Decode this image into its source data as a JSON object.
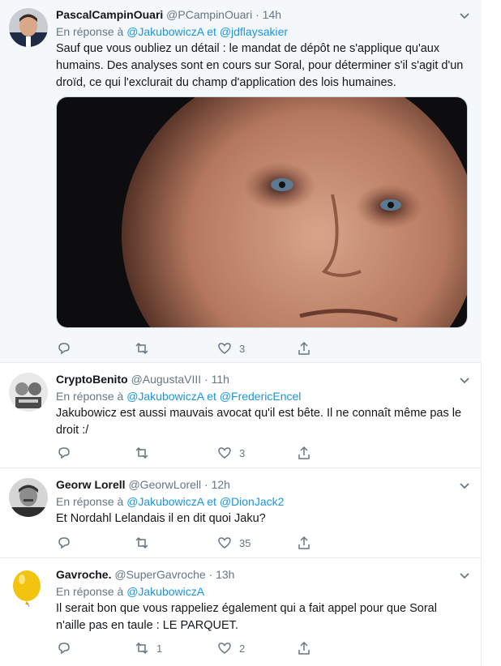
{
  "tweets": [
    {
      "name": "PascalCampinOuari",
      "handle": "@PCampinOuari",
      "dot": "·",
      "time": "14h",
      "reply_prefix": "En réponse à",
      "mentions": [
        "@JakubowiczA",
        "@jdflaysakier"
      ],
      "joiner": "et",
      "text": "Sauf que vous oubliez un détail : le mandat de dépôt ne s'applique qu'aux humains. Des analyses sont en cours sur Soral, pour déterminer s'il s'agit d'un droïd, ce qui l'exclurait du champ d'application des lois humaines.",
      "reply_count": "",
      "retweet_count": "",
      "like_count": "3"
    },
    {
      "name": "CryptoBenito",
      "handle": "@AugustaVIII",
      "dot": "·",
      "time": "11h",
      "reply_prefix": "En réponse à",
      "mentions": [
        "@JakubowiczA",
        "@FredericEncel"
      ],
      "joiner": "et",
      "text": "Jakubowicz est aussi mauvais avocat qu'il est bête. Il ne connaît même pas le droit :/",
      "reply_count": "",
      "retweet_count": "",
      "like_count": "3"
    },
    {
      "name": "Georw Lorell",
      "handle": "@GeorwLorell",
      "dot": "·",
      "time": "12h",
      "reply_prefix": "En réponse à",
      "mentions": [
        "@JakubowiczA",
        "@DionJack2"
      ],
      "joiner": "et",
      "text": "Et Nordahl Lelandais il en dit quoi Jaku?",
      "reply_count": "",
      "retweet_count": "",
      "like_count": "35"
    },
    {
      "name": "Gavroche.",
      "handle": "@SuperGavroche",
      "dot": "·",
      "time": "13h",
      "reply_prefix": "En réponse à",
      "mentions": [
        "@JakubowiczA"
      ],
      "joiner": "",
      "text": "Il serait bon que vous rappeliez également qui a fait appel pour que Soral n'aille pas en taule : LE PARQUET.",
      "reply_count": "",
      "retweet_count": "1",
      "like_count": "2"
    }
  ],
  "icons": {
    "reply": "reply-icon",
    "retweet": "retweet-icon",
    "like": "heart-icon",
    "share": "share-icon",
    "caret": "chevron-down-icon"
  },
  "colors": {
    "link": "#1b95e0",
    "muted": "#657786",
    "text": "#14171a",
    "highlight_bg": "#f5f8fa",
    "border": "#e6ecf0"
  }
}
